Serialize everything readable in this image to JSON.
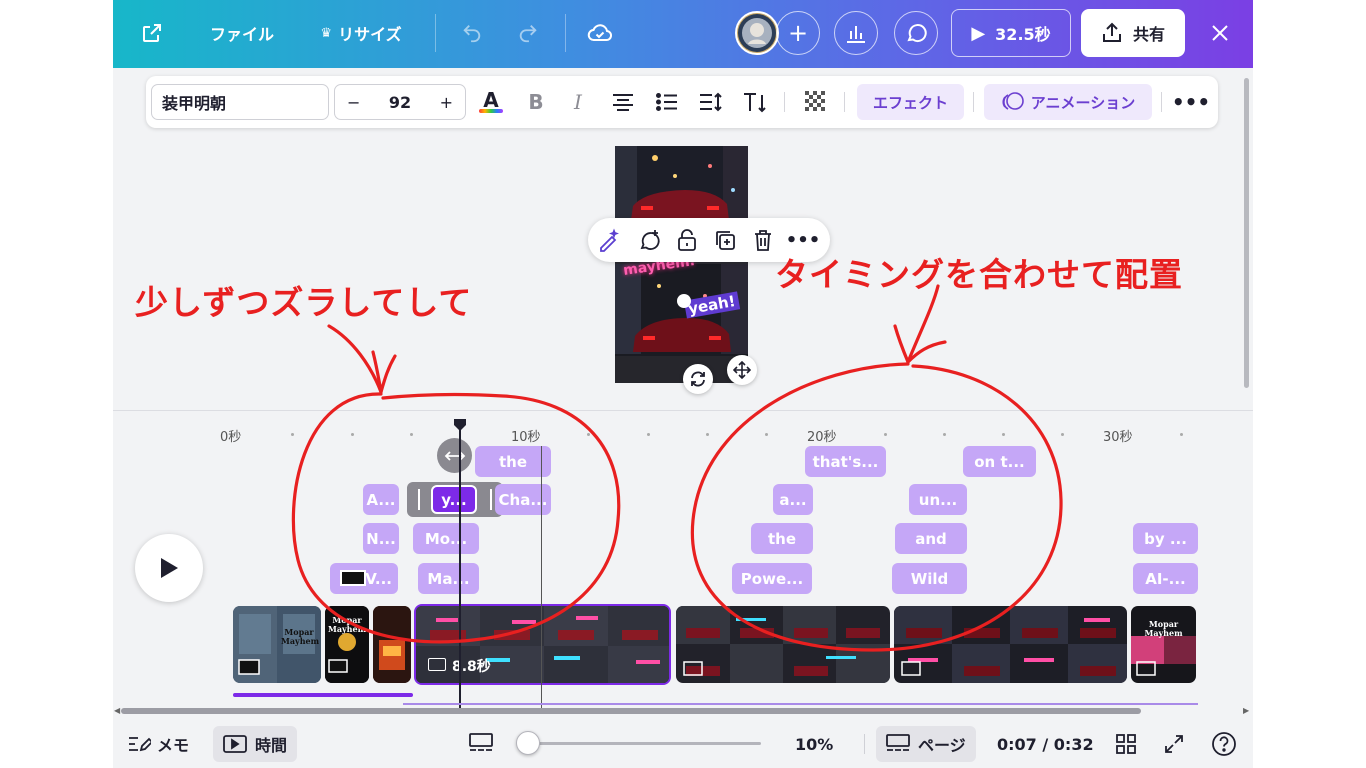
{
  "header": {
    "file": "ファイル",
    "resize": "リサイズ",
    "play_duration": "32.5秒",
    "share": "共有"
  },
  "toolbar": {
    "font": "装甲明朝",
    "minus": "−",
    "font_size": "92",
    "plus": "+",
    "effect": "エフェクト",
    "animation": "アニメーション"
  },
  "preview": {
    "overlay_text_1": "mayhem.",
    "overlay_text_2": "yeah!"
  },
  "timeline": {
    "ticks": [
      "0秒",
      "10秒",
      "20秒",
      "30秒"
    ],
    "clips": {
      "c1": "the",
      "c2": "A...",
      "c3": "y...",
      "c4": "Cha...",
      "c5": "N...",
      "c6": "Mo...",
      "c7": "V...",
      "c8": "Ma...",
      "c9": "that's...",
      "c10": "on t...",
      "c11": "a...",
      "c12": "un...",
      "c13": "the",
      "c14": "and",
      "c15": "Powe...",
      "c16": "Wild",
      "c17": "by ...",
      "c18": "AI-..."
    },
    "selected_duration": "8.8秒",
    "thumb_title": "Mopar Mayhem"
  },
  "bottombar": {
    "memo": "メモ",
    "time": "時間",
    "zoom": "10%",
    "page": "ページ",
    "timecode": "0:07 / 0:32"
  },
  "annotations": {
    "left": "少しずつズラしてして",
    "right": "タイミングを合わせて配置"
  },
  "colors": {
    "accent": "#7d2ae8",
    "clip": "#c5a7f7",
    "annotation": "#e82020"
  }
}
